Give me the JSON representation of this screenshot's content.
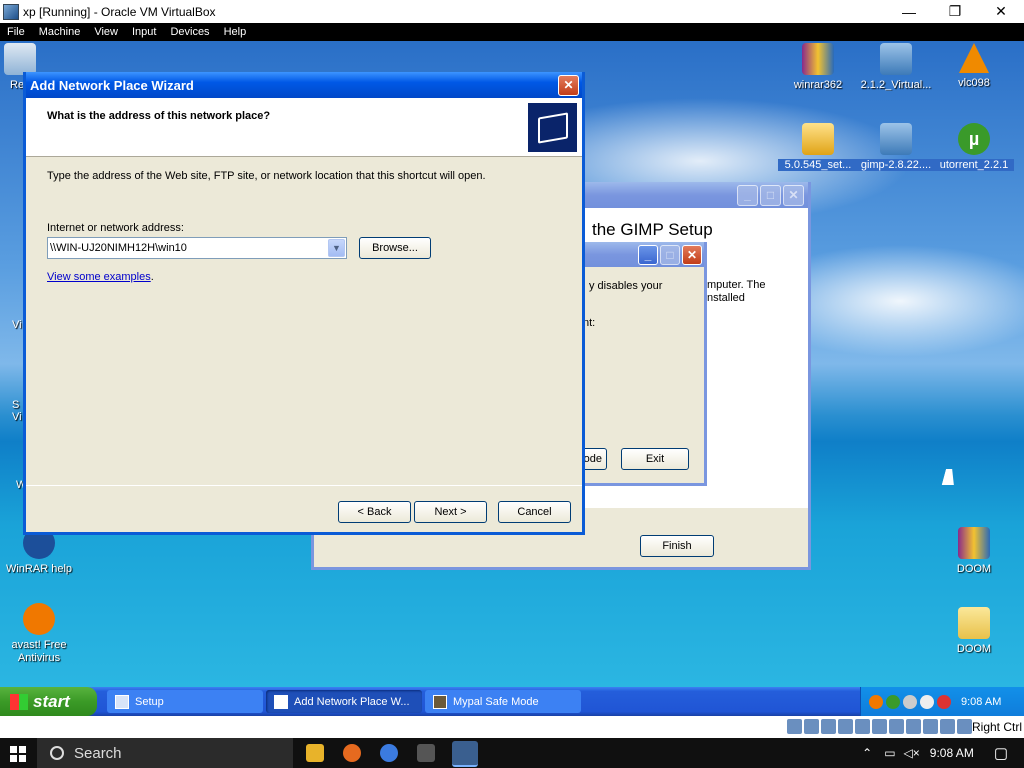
{
  "host": {
    "title": "xp [Running] - Oracle VM VirtualBox",
    "controls": {
      "minimize": "—",
      "maximize": "❐",
      "close": "✕"
    },
    "menu": [
      "File",
      "Machine",
      "View",
      "Input",
      "Devices",
      "Help"
    ]
  },
  "desktop_icons": {
    "winrar362": "winrar362",
    "virtual": "2.1.2_Virtual...",
    "vlc": "vlc098",
    "set": "5.0.545_set...",
    "gimp": "gimp-2.8.22....",
    "utorrent": "utorrent_2.2.1",
    "winrar_help": "WinRAR help",
    "avast": "avast! Free Antivirus",
    "doom1": "DOOM",
    "doom2": "DOOM",
    "left_partial": [
      "Re",
      "Vi",
      "S\nVi",
      "W"
    ]
  },
  "gimp_setup": {
    "heading": "the GIMP Setup",
    "finish": "Finish",
    "inner": {
      "text1": "y disables your",
      "text2": "nt:",
      "text3": "mputer. The\nnstalled",
      "mode": "ode",
      "exit": "Exit"
    }
  },
  "wizard": {
    "title": "Add Network Place Wizard",
    "heading": "What is the address of this network place?",
    "description": "Type the address of the Web site, FTP site, or network location that this shortcut will open.",
    "address_label": "Internet or network address:",
    "address_value": "\\\\WIN-UJ20NIMH12H\\win10",
    "browse": "Browse...",
    "examples_link": "View some examples",
    "examples_period": ".",
    "back": "< Back",
    "next": "Next >",
    "cancel": "Cancel"
  },
  "xp_taskbar": {
    "start": "start",
    "tasks": [
      "Setup",
      "Add Network Place W...",
      "Mypal Safe Mode"
    ],
    "clock": "9:08 AM"
  },
  "vbox_status": {
    "host_key": "Right Ctrl"
  },
  "win10": {
    "search": "Search",
    "clock": "9:08 AM"
  }
}
